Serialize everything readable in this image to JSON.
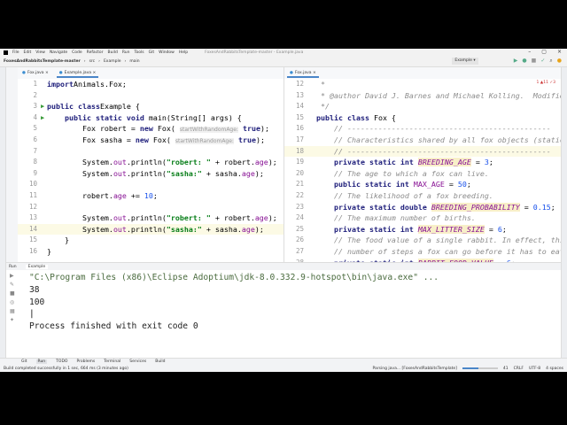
{
  "menu": {
    "items": [
      "File",
      "Edit",
      "View",
      "Navigate",
      "Code",
      "Refactor",
      "Build",
      "Run",
      "Tools",
      "Git",
      "Window",
      "Help"
    ],
    "title": "FoxesAndRabbitsTemplate-master - Example.java"
  },
  "nav": {
    "crumbs": [
      "FoxesAndRabbitsTemplate-master",
      "src",
      "Example",
      "main"
    ],
    "run_config": "Example"
  },
  "left_tabs": [
    {
      "label": "Fox.java"
    },
    {
      "label": "Example.java"
    }
  ],
  "right_tabs": [
    {
      "label": "Fox.java"
    }
  ],
  "inspection": "1 ▲11 ✓3",
  "left_code": [
    {
      "n": "1",
      "t": [
        [
          "kw",
          "import"
        ],
        [
          "",
          "Animals.Fox;"
        ]
      ]
    },
    {
      "n": "2",
      "t": []
    },
    {
      "n": "3",
      "run": true,
      "t": [
        [
          "kw",
          "public class"
        ],
        [
          "",
          "Example {"
        ]
      ]
    },
    {
      "n": "4",
      "run": true,
      "t": [
        [
          "",
          "    "
        ],
        [
          "kw",
          "public static void"
        ],
        [
          "",
          " main(String[] args) {"
        ]
      ]
    },
    {
      "n": "5",
      "t": [
        [
          "",
          "        Fox robert = "
        ],
        [
          "kw",
          "new"
        ],
        [
          "",
          " Fox( "
        ],
        [
          "hint",
          "startWithRandomAge:"
        ],
        [
          "kw",
          " true"
        ],
        [
          "",
          ");"
        ]
      ]
    },
    {
      "n": "6",
      "t": [
        [
          "",
          "        Fox sasha = "
        ],
        [
          "kw",
          "new"
        ],
        [
          "",
          " Fox( "
        ],
        [
          "hint",
          "startWithRandomAge:"
        ],
        [
          "kw",
          " true"
        ],
        [
          "",
          ");"
        ]
      ]
    },
    {
      "n": "7",
      "t": []
    },
    {
      "n": "8",
      "t": [
        [
          "",
          "        System."
        ],
        [
          "fld",
          "out"
        ],
        [
          "",
          ".println("
        ],
        [
          "str",
          "\"robert: \""
        ],
        [
          "",
          " + robert."
        ],
        [
          "fld",
          "age"
        ],
        [
          "",
          ");"
        ]
      ]
    },
    {
      "n": "9",
      "t": [
        [
          "",
          "        System."
        ],
        [
          "fld",
          "out"
        ],
        [
          "",
          ".println("
        ],
        [
          "str",
          "\"sasha:\""
        ],
        [
          "",
          " + sasha."
        ],
        [
          "fld",
          "age"
        ],
        [
          "",
          ");"
        ]
      ]
    },
    {
      "n": "10",
      "t": []
    },
    {
      "n": "11",
      "t": [
        [
          "",
          "        robert."
        ],
        [
          "fld",
          "age"
        ],
        [
          "",
          " += "
        ],
        [
          "num",
          "10"
        ],
        [
          "",
          ";"
        ]
      ]
    },
    {
      "n": "12",
      "t": []
    },
    {
      "n": "13",
      "t": [
        [
          "",
          "        System."
        ],
        [
          "fld",
          "out"
        ],
        [
          "",
          ".println("
        ],
        [
          "str",
          "\"robert: \""
        ],
        [
          "",
          " + robert."
        ],
        [
          "fld",
          "age"
        ],
        [
          "",
          ");"
        ]
      ]
    },
    {
      "n": "14",
      "cur": true,
      "t": [
        [
          "",
          "        System."
        ],
        [
          "fld",
          "out"
        ],
        [
          "",
          ".println("
        ],
        [
          "str",
          "\"sasha:\""
        ],
        [
          "",
          " + sasha."
        ],
        [
          "fld",
          "age"
        ],
        [
          "",
          ");"
        ]
      ]
    },
    {
      "n": "15",
      "t": [
        [
          "",
          "    }"
        ]
      ]
    },
    {
      "n": "16",
      "t": [
        [
          "",
          "}"
        ]
      ]
    }
  ],
  "right_code": [
    {
      "n": "12",
      "t": [
        [
          "cm",
          " *"
        ]
      ]
    },
    {
      "n": "13",
      "t": [
        [
          "cm",
          " * @author David J. Barnes and Michael Kolling.  Modified by David Dobervich"
        ]
      ]
    },
    {
      "n": "14",
      "t": [
        [
          "cm",
          " */"
        ]
      ]
    },
    {
      "n": "15",
      "t": [
        [
          "kw",
          "public class"
        ],
        [
          "",
          " Fox {"
        ]
      ]
    },
    {
      "n": "16",
      "t": [
        [
          "cm",
          "    // ----------------------------------------------"
        ]
      ]
    },
    {
      "n": "17",
      "t": [
        [
          "cm",
          "    // Characteristics shared by all fox objects (static fields)."
        ]
      ]
    },
    {
      "n": "18",
      "cur": true,
      "t": [
        [
          "cm",
          "    // ----------------------------------------------"
        ]
      ]
    },
    {
      "n": "19",
      "t": [
        [
          "",
          "    "
        ],
        [
          "kw",
          "private static int"
        ],
        [
          "",
          " "
        ],
        [
          "cst",
          "BREEDING_AGE"
        ],
        [
          "",
          " = "
        ],
        [
          "num",
          "3"
        ],
        [
          "",
          ";"
        ]
      ]
    },
    {
      "n": "20",
      "t": [
        [
          "cm",
          "    // The age to which a fox can live."
        ]
      ]
    },
    {
      "n": "21",
      "t": [
        [
          "",
          "    "
        ],
        [
          "kw",
          "public static int"
        ],
        [
          "",
          " "
        ],
        [
          "fld",
          "MAX_AGE"
        ],
        [
          "",
          " = "
        ],
        [
          "num",
          "50"
        ],
        [
          "",
          ";"
        ]
      ]
    },
    {
      "n": "22",
      "t": [
        [
          "cm",
          "    // The likelihood of a fox breeding."
        ]
      ]
    },
    {
      "n": "23",
      "t": [
        [
          "",
          "    "
        ],
        [
          "kw",
          "private static double"
        ],
        [
          "",
          " "
        ],
        [
          "cst",
          "BREEDING_PROBABILITY"
        ],
        [
          "",
          " = "
        ],
        [
          "num",
          "0.15"
        ],
        [
          "",
          ";"
        ]
      ]
    },
    {
      "n": "24",
      "t": [
        [
          "cm",
          "    // The maximum number of births."
        ]
      ]
    },
    {
      "n": "25",
      "t": [
        [
          "",
          "    "
        ],
        [
          "kw",
          "private static int"
        ],
        [
          "",
          " "
        ],
        [
          "cst",
          "MAX_LITTER_SIZE"
        ],
        [
          "",
          " = "
        ],
        [
          "num",
          "6"
        ],
        [
          "",
          ";"
        ]
      ]
    },
    {
      "n": "26",
      "t": [
        [
          "cm",
          "    // The food value of a single rabbit. In effect, this is the"
        ]
      ]
    },
    {
      "n": "27",
      "t": [
        [
          "cm",
          "    // number of steps a fox can go before it has to eat again."
        ]
      ]
    },
    {
      "n": "28",
      "t": [
        [
          "",
          "    "
        ],
        [
          "kw",
          "private static int"
        ],
        [
          "",
          " "
        ],
        [
          "cst",
          "RABBIT_FOOD_VALUE"
        ],
        [
          "",
          " = "
        ],
        [
          "num",
          "6"
        ],
        [
          "",
          ";"
        ]
      ]
    }
  ],
  "run": {
    "label": "Run",
    "tab": "Example",
    "console": [
      "\"C:\\Program Files (x86)\\Eclipse Adoptium\\jdk-8.0.332.9-hotspot\\bin\\java.exe\" ...",
      "38",
      "100",
      "|",
      "Process finished with exit code 0"
    ]
  },
  "bottom_tabs": [
    "Git",
    "Run",
    "TODO",
    "Problems",
    "Terminal",
    "Services",
    "Build"
  ],
  "status": {
    "message": "Build completed successfully in 1 sec, 664 ms (3 minutes ago)",
    "task": "Parsing java... [FoxesAndRabbitsTemplate]",
    "progress": 0.45,
    "position": "41",
    "line_sep": "CRLF",
    "encoding": "UTF-8",
    "indent": "4 spaces"
  }
}
